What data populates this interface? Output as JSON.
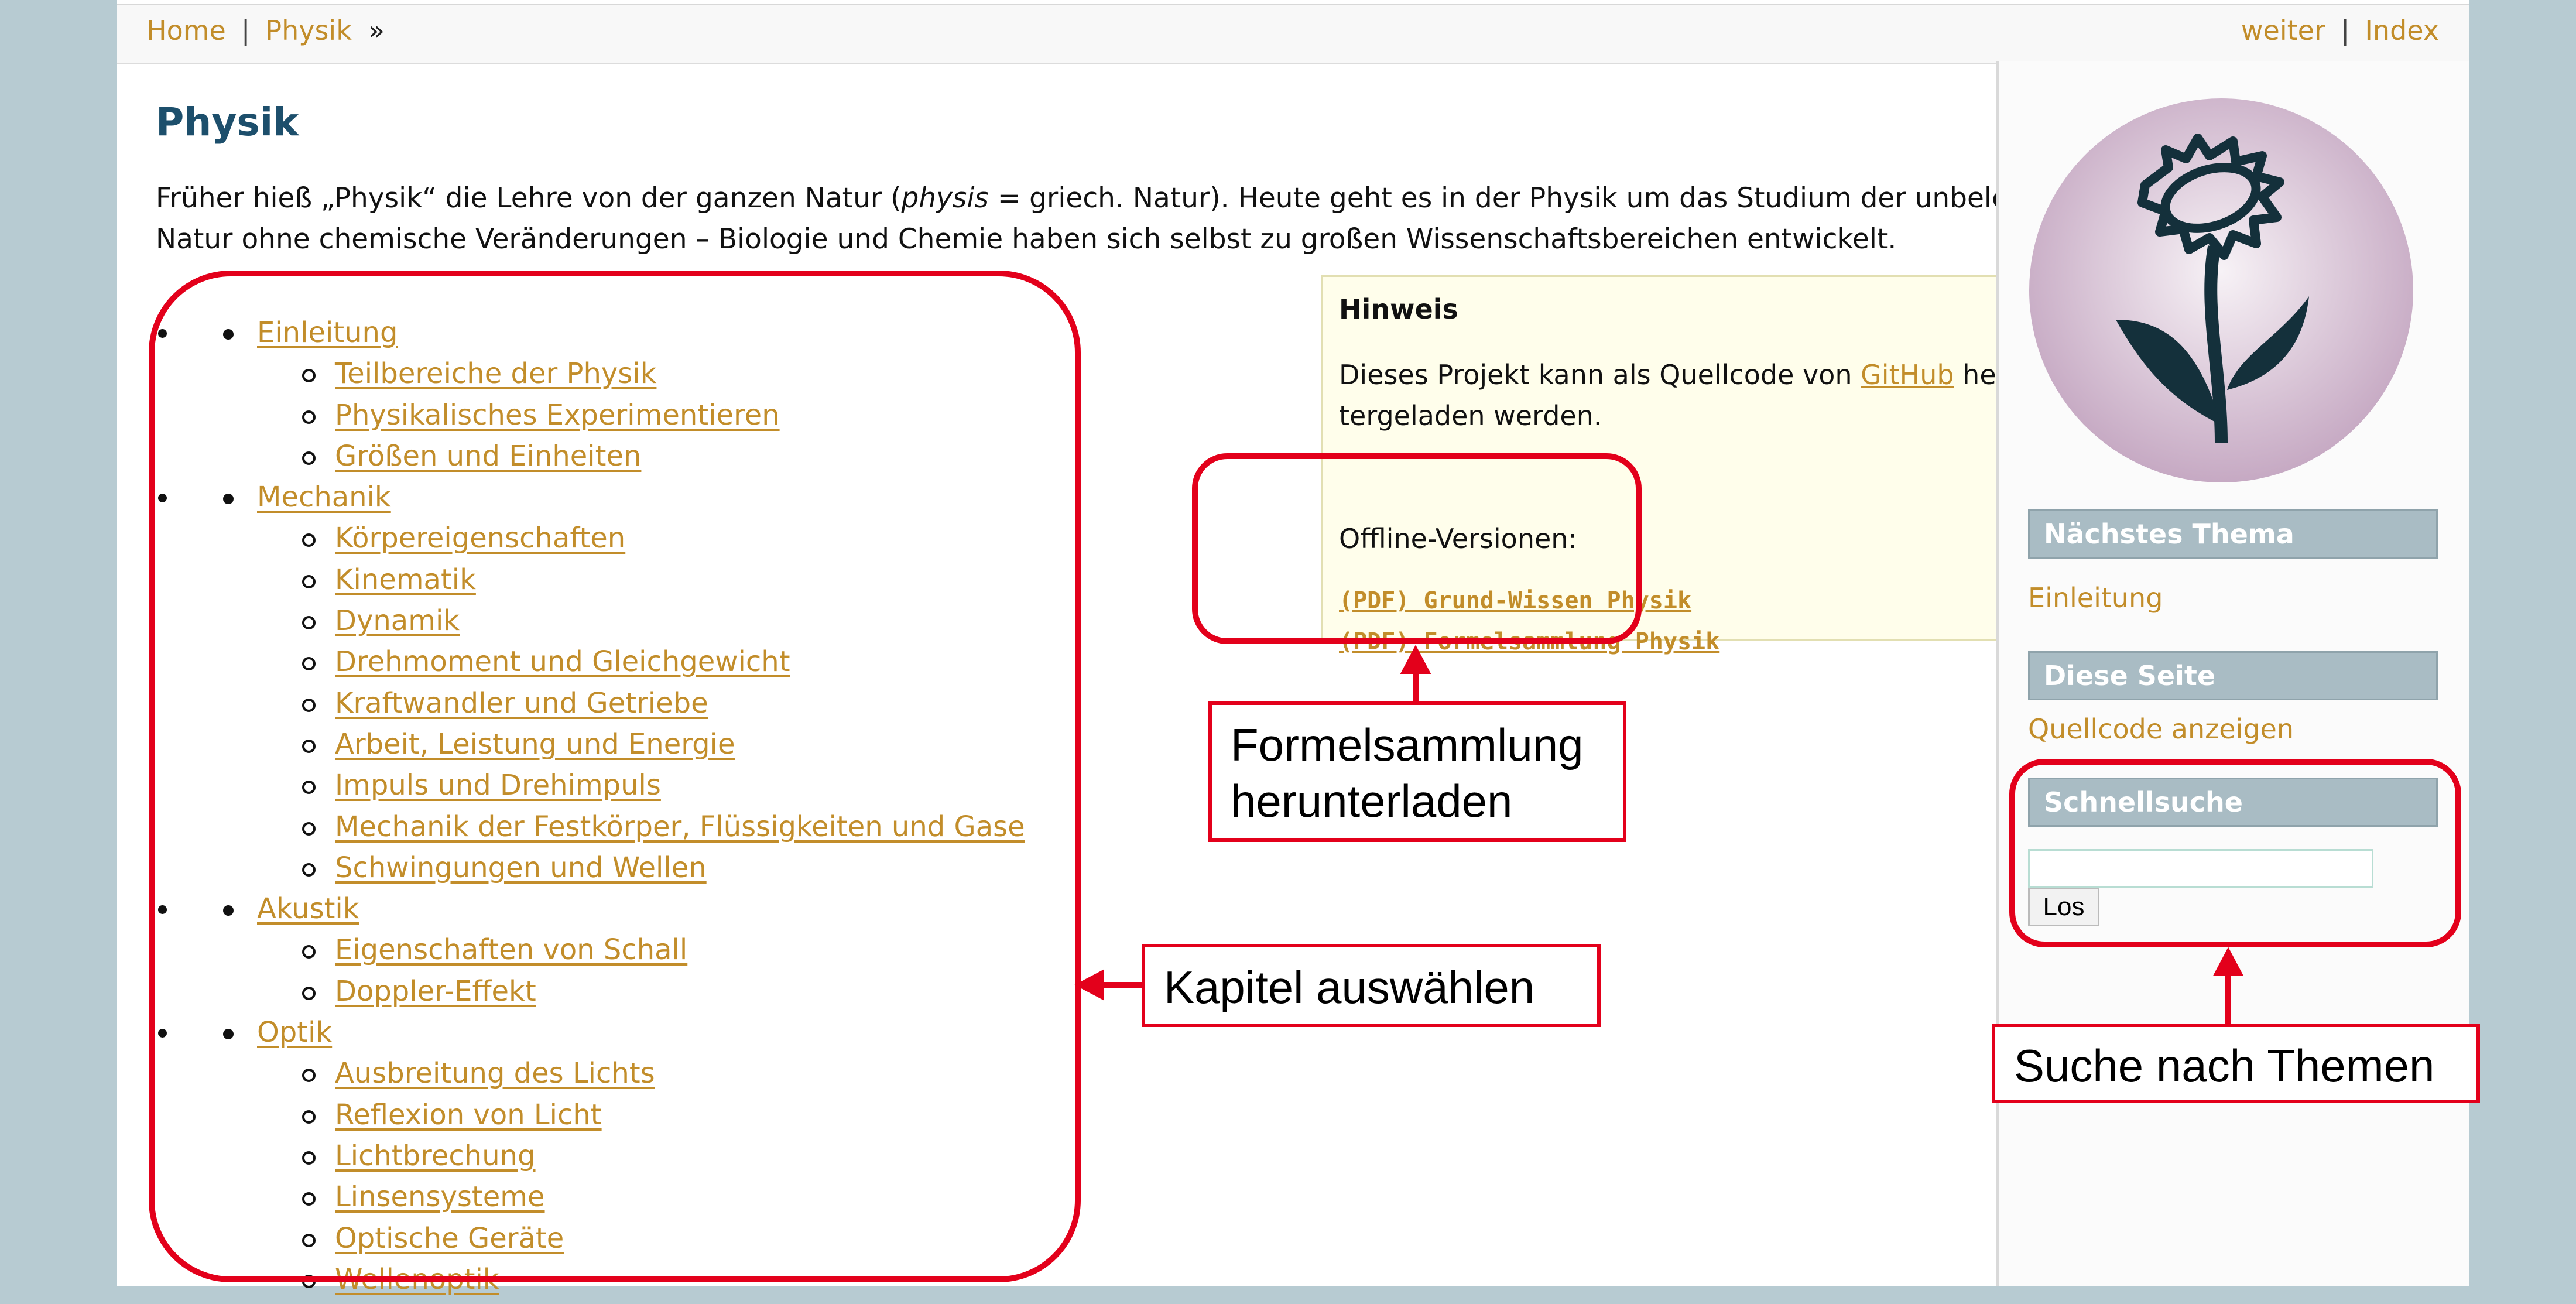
{
  "breadcrumb": {
    "home": "Home",
    "separator": "|",
    "physik": "Physik",
    "raquo": "»"
  },
  "topnav_right": {
    "weiter": "weiter",
    "separator": "|",
    "index": "Index"
  },
  "title": "Physik",
  "intro": {
    "before": "Früher hieß „Physik“ die Lehre von der ganzen Natur (",
    "italic": "physis",
    "after": " = griech. Natur). Heute geht es in der Physik um das Studium der unbelebten Natur ohne chemische Veränderungen – Biologie und Chemie haben sich selbst zu großen Wissenschaftsbereichen entwickelt."
  },
  "toc": [
    {
      "label": "Einleitung",
      "children": [
        "Teilbereiche der Physik",
        "Physikalisches Experimentieren",
        "Größen und Einheiten"
      ]
    },
    {
      "label": "Mechanik",
      "children": [
        "Körpereigenschaften",
        "Kinematik",
        "Dynamik",
        "Drehmoment und Gleichgewicht",
        "Kraftwandler und Getriebe",
        "Arbeit, Leistung und Energie",
        "Impuls und Drehimpuls",
        "Mechanik der Festkörper, Flüssigkeiten und Gase",
        "Schwingungen und Wellen"
      ]
    },
    {
      "label": "Akustik",
      "children": [
        "Eigenschaften von Schall",
        "Doppler-Effekt"
      ]
    },
    {
      "label": "Optik",
      "children": [
        "Ausbreitung des Lichts",
        "Reflexion von Licht",
        "Lichtbrechung",
        "Linsensysteme",
        "Optische Geräte",
        "Wellenoptik"
      ]
    }
  ],
  "hint": {
    "title": "Hinweis",
    "text_before": "Dieses Projekt kann als Quellcode von ",
    "github": "GitHub",
    "text_after": " herun-tergeladen werden.",
    "offline_label": "Offline-Versionen:",
    "pdf1": "(PDF) Grund-Wissen Physik",
    "pdf2": "(PDF) Formelsammlung Physik"
  },
  "sidebar": {
    "next_heading": "Nächstes Thema",
    "next_link": "Einleitung",
    "page_heading": "Diese Seite",
    "source_link": "Quellcode anzeigen",
    "search_heading": "Schnellsuche",
    "search_value": "",
    "search_button": "Los"
  },
  "annotations": {
    "formel": [
      "Formelsammlung",
      "herunterladen"
    ],
    "kapitel": "Kapitel auswählen",
    "suche": "Suche nach Themen"
  },
  "colors": {
    "accent": "#e3001b",
    "link": "#c28d2a",
    "title": "#1d4f6c",
    "background": "#b7cbd2",
    "sidebar_heading": "#a9bcc4"
  },
  "icons": {
    "logo": "sunflower-logo-icon"
  }
}
